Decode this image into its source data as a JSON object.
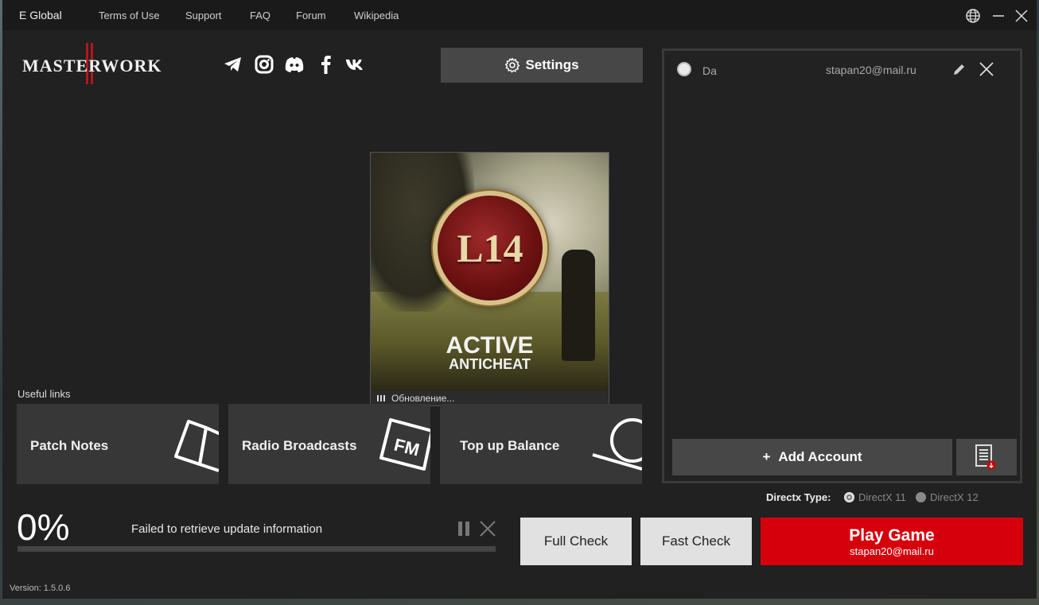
{
  "topbar": {
    "brand": "E Global",
    "links": [
      "Terms of Use",
      "Support",
      "FAQ",
      "Forum",
      "Wikipedia"
    ]
  },
  "logo": {
    "text": "MASTERWORK"
  },
  "socials": [
    "telegram-icon",
    "instagram-icon",
    "discord-icon",
    "facebook-icon",
    "vk-icon"
  ],
  "settings": {
    "label": "Settings"
  },
  "anticheat": {
    "emblem": "L14",
    "title_main": "ACTIVE",
    "title_sub": "ANTICHEAT",
    "status": "Обновление..."
  },
  "useful_links": {
    "label": "Useful links",
    "cards": [
      {
        "label": "Patch Notes",
        "icon": "book-icon"
      },
      {
        "label": "Radio Broadcasts",
        "icon": "fm-radio-icon"
      },
      {
        "label": "Top up Balance",
        "icon": "coin-icon"
      }
    ]
  },
  "accounts": {
    "items": [
      {
        "name": "Da",
        "email": "stapan20@mail.ru"
      }
    ],
    "add_label": "Add Account"
  },
  "directx": {
    "label": "Directx Type:",
    "options": [
      "DirectX 11",
      "DirectX 12"
    ],
    "selected": "DirectX 11"
  },
  "progress": {
    "percent_text": "0%",
    "value": 0,
    "message": "Failed to retrieve update information"
  },
  "actions": {
    "full_check": "Full Check",
    "fast_check": "Fast Check",
    "play": "Play Game",
    "play_account": "stapan20@mail.ru"
  },
  "version": "Version: 1.5.0.6",
  "colors": {
    "accent_red": "#d6000d",
    "panel": "#212121",
    "button_gray": "#474747"
  }
}
